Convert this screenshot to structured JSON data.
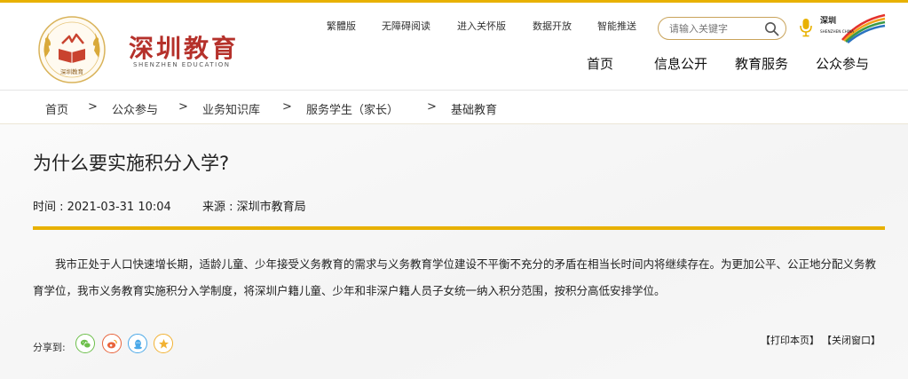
{
  "header": {
    "logo_text": "深圳教育",
    "logo_subtitle": "SHENZHEN EDUCATION",
    "emblem_text": "深圳教育",
    "utility_links": [
      "繁體版",
      "无障碍阅读",
      "进入关怀版",
      "数据开放",
      "智能推送"
    ],
    "search": {
      "placeholder": "请输入关键字"
    },
    "sz_china_logo_text": "深圳 SHENZHEN CHINA",
    "main_nav": [
      "首页",
      "信息公开",
      "教育服务",
      "公众参与"
    ],
    "brand_color": "#b5312b",
    "accent_color": "#e8b100"
  },
  "breadcrumb": {
    "items": [
      "首页",
      "公众参与",
      "业务知识库",
      "服务学生（家长）",
      "基础教育"
    ],
    "separator": ">"
  },
  "article": {
    "title": "为什么要实施积分入学?",
    "time_label": "时间 : 2021-03-31 10:04",
    "source_label": "来源 : 深圳市教育局",
    "body": "我市正处于人口快速增长期，适龄儿童、少年接受义务教育的需求与义务教育学位建设不平衡不充分的矛盾在相当长时间内将继续存在。为更加公平、公正地分配义务教育学位，我市义务教育实施积分入学制度，将深圳户籍儿童、少年和非深户籍人员子女统一纳入积分范围，按积分高低安排学位。"
  },
  "share": {
    "label": "分享到:",
    "buttons": [
      {
        "name": "wechat",
        "icon": "wechat-icon",
        "color": "#6dbf4b"
      },
      {
        "name": "weibo",
        "icon": "weibo-icon",
        "color": "#e8643c"
      },
      {
        "name": "qq",
        "icon": "qq-icon",
        "color": "#4aa8e8"
      },
      {
        "name": "qzone",
        "icon": "star-icon",
        "color": "#f2b233"
      }
    ]
  },
  "actions": {
    "print": "【打印本页】",
    "close": "【关闭窗口】"
  }
}
